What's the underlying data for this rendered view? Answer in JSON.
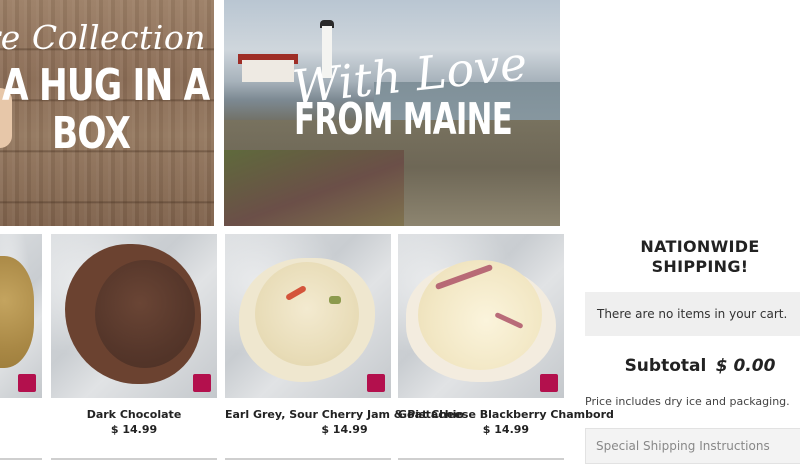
{
  "banners": {
    "hug": {
      "script": "ure Collection",
      "line1": "A HUG IN A",
      "line2": "BOX"
    },
    "maine": {
      "script": "With Love",
      "block": "FROM MAINE"
    }
  },
  "products": [
    {
      "name": "",
      "price": ""
    },
    {
      "name": "Dark Chocolate",
      "price": "$ 14.99"
    },
    {
      "name": "Earl Grey, Sour Cherry Jam & Pistachio",
      "price": "$ 14.99"
    },
    {
      "name": "Goat Cheese Blackberry Chambord",
      "price": "$ 14.99"
    }
  ],
  "cart": {
    "heading": "NATIONWIDE SHIPPING!",
    "empty_message": "There are no items in your cart.",
    "subtotal_label": "Subtotal",
    "subtotal_value": "$ 0.00",
    "note": "Price includes dry ice and packaging.",
    "instructions_placeholder": "Special Shipping Instructions"
  },
  "colors": {
    "add_button": "#b3104d"
  }
}
